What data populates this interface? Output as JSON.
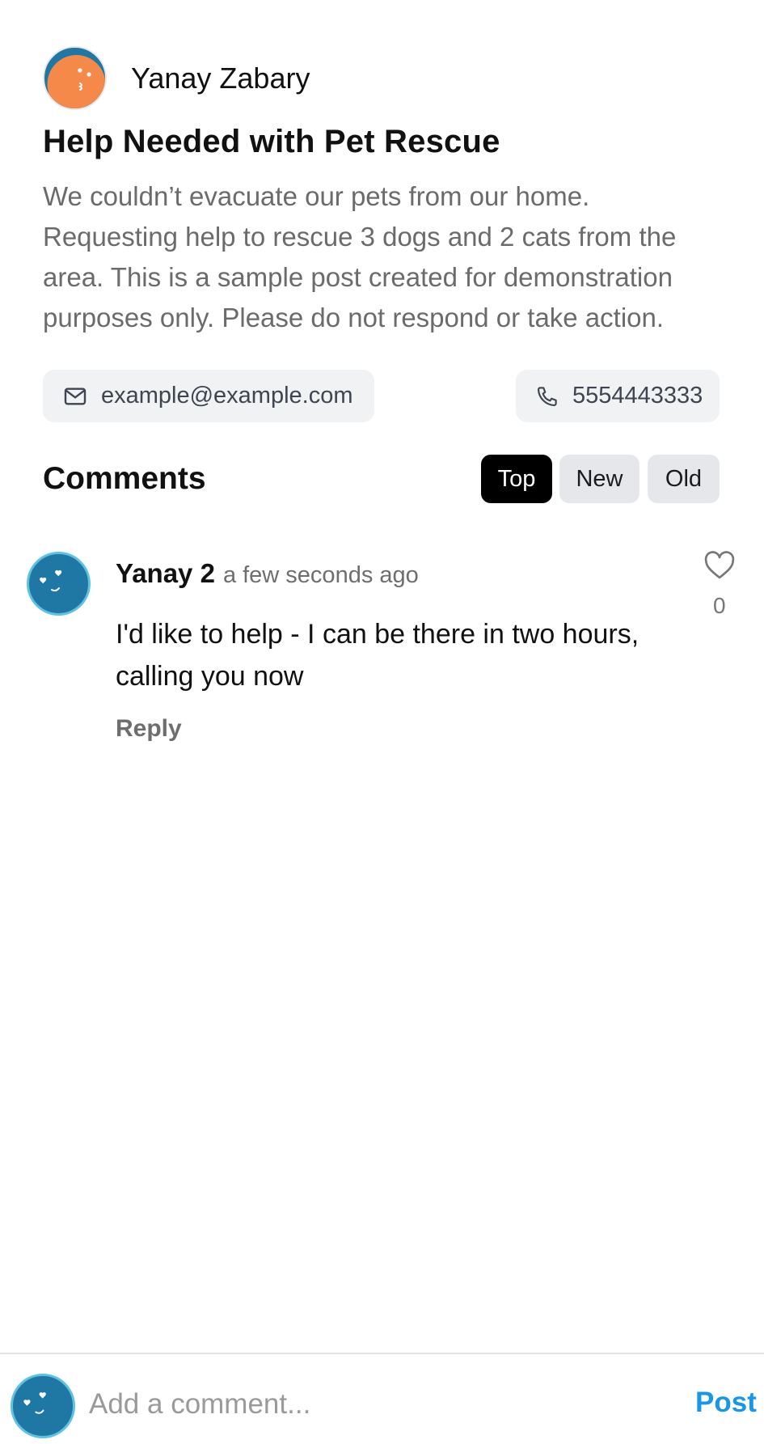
{
  "post": {
    "author": "Yanay Zabary",
    "title": "Help Needed with Pet Rescue",
    "body": "We couldn’t evacuate our pets from our home. Requesting help to rescue 3 dogs and 2 cats from the area. This is a sample post created for demonstration purposes only. Please do not respond or take action.",
    "email": "example@example.com",
    "phone": "5554443333",
    "author_avatar_color": "#f5894a"
  },
  "comments_section": {
    "title": "Comments",
    "sort_options": {
      "top": "Top",
      "new": "New",
      "old": "Old"
    },
    "active_sort": "Top",
    "items": [
      {
        "user": "Yanay 2",
        "time": "a few seconds ago",
        "text": "I'd like to help - I can be there in two hours, calling you now",
        "reply_label": "Reply",
        "likes": "0"
      }
    ]
  },
  "composer": {
    "placeholder": "Add a comment...",
    "post_label": "Post"
  },
  "colors": {
    "accent": "#1897e6",
    "avatar_blue": "#1f77a3",
    "avatar_ring": "#5ec3e3",
    "active_sort_bg": "#000000"
  }
}
